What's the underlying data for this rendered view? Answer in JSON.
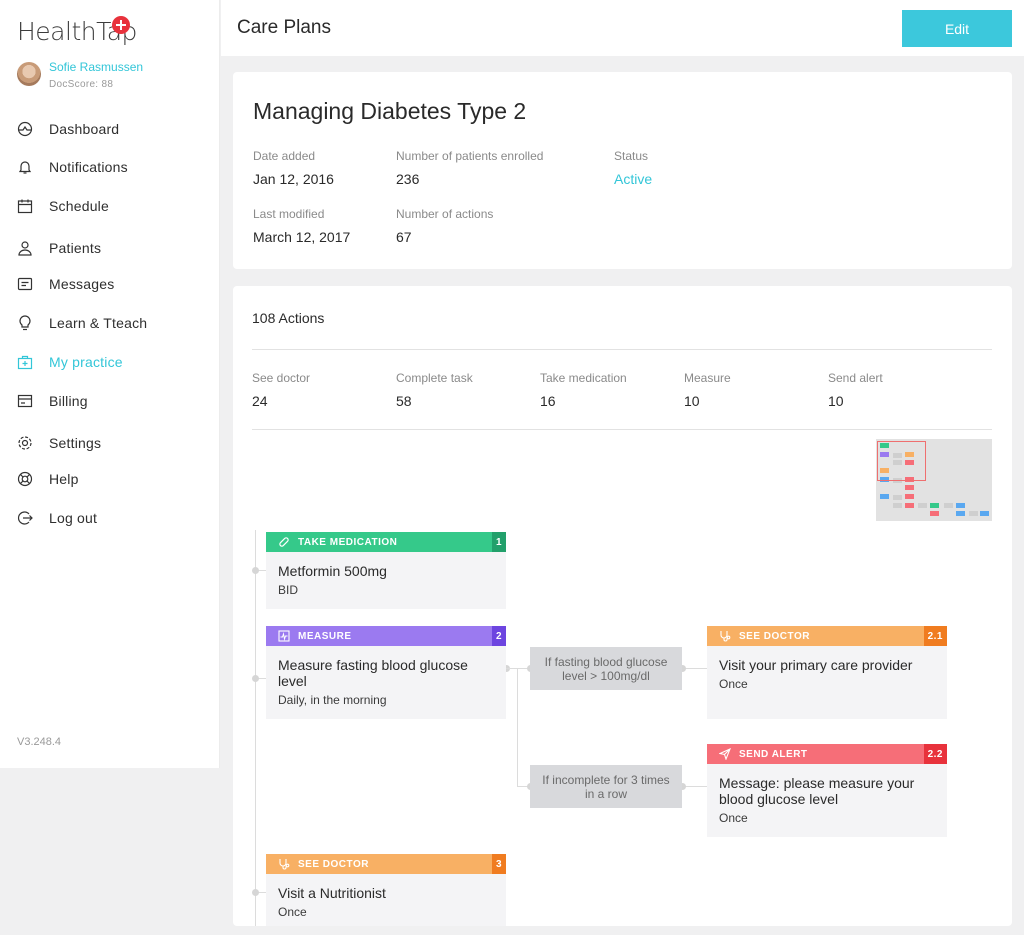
{
  "brand": {
    "logo_text": "HealthTap"
  },
  "user": {
    "name": "Sofie Rasmussen",
    "docscore": "DocScore: 88"
  },
  "nav": [
    {
      "label": "Dashboard",
      "icon": "dashboard-icon",
      "active": false
    },
    {
      "label": "Notifications",
      "icon": "bell-icon",
      "active": false
    },
    {
      "label": "Schedule",
      "icon": "calendar-icon",
      "active": false
    },
    {
      "label": "Patients",
      "icon": "person-icon",
      "active": false
    },
    {
      "label": "Messages",
      "icon": "message-icon",
      "active": false
    },
    {
      "label": "Learn & Tteach",
      "icon": "lightbulb-icon",
      "active": false
    },
    {
      "label": "My practice",
      "icon": "medical-bag-icon",
      "active": true
    },
    {
      "label": "Billing",
      "icon": "billing-icon",
      "active": false
    },
    {
      "label": "Settings",
      "icon": "gear-icon",
      "active": false
    },
    {
      "label": "Help",
      "icon": "lifebuoy-icon",
      "active": false
    },
    {
      "label": "Log out",
      "icon": "logout-icon",
      "active": false
    }
  ],
  "version": "V3.248.4",
  "header": {
    "title": "Care Plans",
    "edit_label": "Edit"
  },
  "plan": {
    "title": "Managing Diabetes Type 2",
    "date_added_label": "Date added",
    "date_added": "Jan 12, 2016",
    "enrolled_label": "Number of patients enrolled",
    "enrolled": "236",
    "status_label": "Status",
    "status": "Active",
    "last_modified_label": "Last modified",
    "last_modified": "March 12, 2017",
    "actions_count_label": "Number of actions",
    "actions_count": "67"
  },
  "actions": {
    "title": "108 Actions",
    "stats": [
      {
        "label": "See doctor",
        "value": "24"
      },
      {
        "label": "Complete task",
        "value": "58"
      },
      {
        "label": "Take medication",
        "value": "16"
      },
      {
        "label": "Measure",
        "value": "10"
      },
      {
        "label": "Send alert",
        "value": "10"
      }
    ]
  },
  "flow": {
    "nodes": [
      {
        "type": "TAKE MEDICATION",
        "num": "1",
        "title": "Metformin 500mg",
        "sub": "BID",
        "color": "#35c98a",
        "num_color": "#22a06b",
        "icon": "pill-icon"
      },
      {
        "type": "MEASURE",
        "num": "2",
        "title": "Measure fasting blood glucose level",
        "sub": "Daily, in the morning",
        "color": "#9b7af0",
        "num_color": "#6d45e0",
        "icon": "chart-pulse-icon"
      },
      {
        "type": "SEE DOCTOR",
        "num": "2.1",
        "title": "Visit your primary care provider",
        "sub": "Once",
        "color": "#f8b064",
        "num_color": "#f07c20",
        "icon": "stethoscope-icon"
      },
      {
        "type": "SEND ALERT",
        "num": "2.2",
        "title": "Message: please measure your blood glucose level",
        "sub": "Once",
        "color": "#f66e78",
        "num_color": "#e8323c",
        "icon": "send-icon"
      },
      {
        "type": "SEE DOCTOR",
        "num": "3",
        "title": "Visit a Nutritionist",
        "sub": "Once",
        "color": "#f8b064",
        "num_color": "#f07c20",
        "icon": "stethoscope-icon"
      }
    ],
    "conditions": [
      {
        "text": "If fasting blood glucose level > 100mg/dl"
      },
      {
        "text": "If incomplete for 3 times in a row"
      }
    ]
  },
  "colors": {
    "accent": "#33c6d8",
    "button": "#3cc8dc"
  }
}
